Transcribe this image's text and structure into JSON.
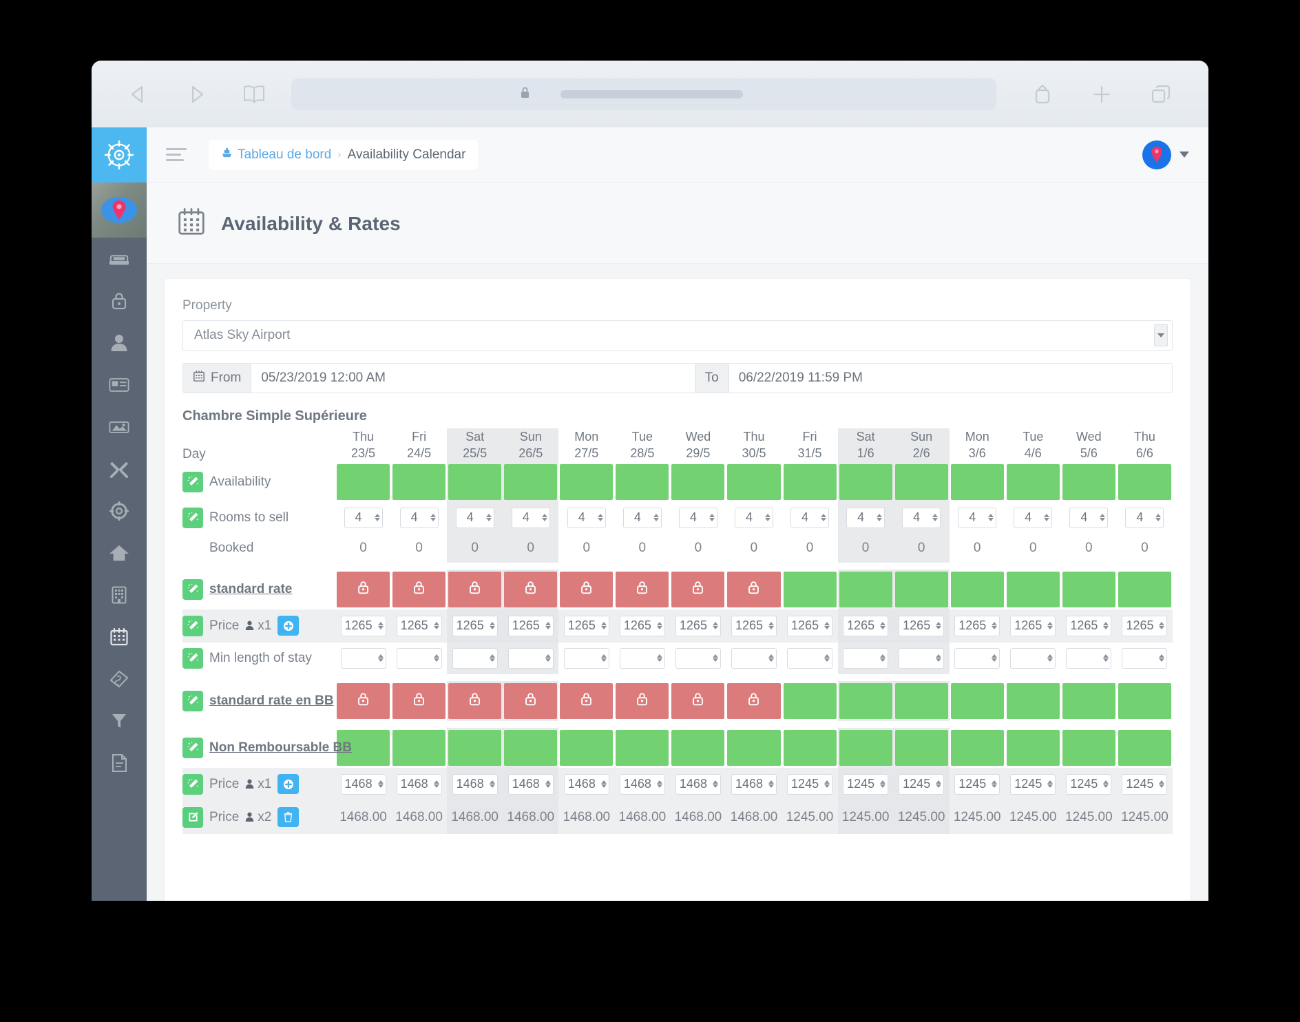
{
  "browser": {
    "back_icon": "chevron-left-icon",
    "forward_icon": "chevron-right-icon",
    "bookmarks_icon": "book-icon",
    "lock_icon": "lock-icon",
    "share_icon": "share-icon",
    "new_tab_icon": "plus-icon",
    "tabs_icon": "tabs-icon",
    "url_value": ""
  },
  "sidebar": {
    "logo_icon": "ship-wheel-icon",
    "property_icon": "map-pin-icon",
    "items": [
      {
        "icon": "bed-icon",
        "name": "sidebar-item-rooms"
      },
      {
        "icon": "lock-icon",
        "name": "sidebar-item-security"
      },
      {
        "icon": "user-icon",
        "name": "sidebar-item-users"
      },
      {
        "icon": "id-card-icon",
        "name": "sidebar-item-profile"
      },
      {
        "icon": "images-icon",
        "name": "sidebar-item-photos"
      },
      {
        "icon": "tools-icon",
        "name": "sidebar-item-tools"
      },
      {
        "icon": "gear-icon",
        "name": "sidebar-item-settings"
      },
      {
        "icon": "home-icon",
        "name": "sidebar-item-home"
      },
      {
        "icon": "building-icon",
        "name": "sidebar-item-property"
      },
      {
        "icon": "calendar-icon",
        "name": "sidebar-item-calendar"
      },
      {
        "icon": "tag-icon",
        "name": "sidebar-item-rates"
      },
      {
        "icon": "filter-icon",
        "name": "sidebar-item-filters"
      },
      {
        "icon": "invoice-icon",
        "name": "sidebar-item-invoices"
      }
    ]
  },
  "topbar": {
    "menu_icon": "hamburger-icon",
    "breadcrumb": {
      "home_icon": "ship-icon",
      "home_label": "Tableau de bord",
      "separator": "›",
      "current_label": "Availability Calendar"
    },
    "avatar_icon": "map-pin-avatar",
    "caret_icon": "chevron-down-icon"
  },
  "page": {
    "icon": "calendar-icon",
    "title": "Availability & Rates"
  },
  "filters": {
    "property_label": "Property",
    "property_value": "Atlas Sky Airport",
    "property_arrow_icon": "chevron-down-icon",
    "from_icon": "calendar-icon",
    "from_label": "From",
    "from_value": "05/23/2019 12:00 AM",
    "to_label": "To",
    "to_value": "06/22/2019 11:59 PM"
  },
  "calendar": {
    "room_title": "Chambre Simple Supérieure",
    "day_header_label": "Day",
    "days": [
      {
        "dow": "Thu",
        "date": "23/5",
        "weekend": false
      },
      {
        "dow": "Fri",
        "date": "24/5",
        "weekend": false
      },
      {
        "dow": "Sat",
        "date": "25/5",
        "weekend": true
      },
      {
        "dow": "Sun",
        "date": "26/5",
        "weekend": true
      },
      {
        "dow": "Mon",
        "date": "27/5",
        "weekend": false
      },
      {
        "dow": "Tue",
        "date": "28/5",
        "weekend": false
      },
      {
        "dow": "Wed",
        "date": "29/5",
        "weekend": false
      },
      {
        "dow": "Thu",
        "date": "30/5",
        "weekend": false
      },
      {
        "dow": "Fri",
        "date": "31/5",
        "weekend": false
      },
      {
        "dow": "Sat",
        "date": "1/6",
        "weekend": true
      },
      {
        "dow": "Sun",
        "date": "2/6",
        "weekend": true
      },
      {
        "dow": "Mon",
        "date": "3/6",
        "weekend": false
      },
      {
        "dow": "Tue",
        "date": "4/6",
        "weekend": false
      },
      {
        "dow": "Wed",
        "date": "5/6",
        "weekend": false
      },
      {
        "dow": "Thu",
        "date": "6/6",
        "weekend": false
      }
    ],
    "rows": [
      {
        "name": "availability-row",
        "label": "Availability",
        "wand_icon": "magic-wand-icon",
        "type": "bar",
        "values": [
          "green",
          "green",
          "green",
          "green",
          "green",
          "green",
          "green",
          "green",
          "green",
          "green",
          "green",
          "green",
          "green",
          "green",
          "green"
        ]
      },
      {
        "name": "rooms-to-sell-row",
        "label": "Rooms to sell",
        "wand_icon": "magic-wand-icon",
        "type": "spinner",
        "values": [
          "4",
          "4",
          "4",
          "4",
          "4",
          "4",
          "4",
          "4",
          "4",
          "4",
          "4",
          "4",
          "4",
          "4",
          "4"
        ]
      },
      {
        "name": "booked-row",
        "label": "Booked",
        "wand_icon": null,
        "type": "text",
        "values": [
          "0",
          "0",
          "0",
          "0",
          "0",
          "0",
          "0",
          "0",
          "0",
          "0",
          "0",
          "0",
          "0",
          "0",
          "0"
        ]
      },
      {
        "name": "standard-rate-row",
        "label": "standard rate",
        "wand_icon": "magic-wand-icon",
        "type": "bar",
        "link": true,
        "values": [
          "red",
          "red",
          "red",
          "red",
          "red",
          "red",
          "red",
          "red",
          "green",
          "green",
          "green",
          "green",
          "green",
          "green",
          "green"
        ]
      },
      {
        "name": "standard-rate-price-x1-row",
        "label": "Price",
        "occupancy": "x1",
        "occupancy_icon": "person-icon",
        "wand_icon": "magic-wand-icon",
        "action_icon": "plus-circle-icon",
        "shaded": true,
        "type": "spinner-wide",
        "values": [
          "1265",
          "1265",
          "1265",
          "1265",
          "1265",
          "1265",
          "1265",
          "1265",
          "1265",
          "1265",
          "1265",
          "1265",
          "1265",
          "1265",
          "1265"
        ]
      },
      {
        "name": "min-length-of-stay-row",
        "label": "Min length of stay",
        "wand_icon": "magic-wand-icon",
        "type": "spinner-empty",
        "values": [
          "",
          "",
          "",
          "",
          "",
          "",
          "",
          "",
          "",
          "",
          "",
          "",
          "",
          "",
          ""
        ]
      },
      {
        "name": "standard-rate-en-bb-row",
        "label": "standard rate en BB",
        "wand_icon": "magic-wand-icon",
        "type": "bar",
        "link": true,
        "values": [
          "red",
          "red",
          "red",
          "red",
          "red",
          "red",
          "red",
          "red",
          "green",
          "green",
          "green",
          "green",
          "green",
          "green",
          "green"
        ]
      },
      {
        "name": "non-remboursable-bb-row",
        "label": "Non Remboursable BB",
        "wand_icon": "magic-wand-icon",
        "type": "bar",
        "link": true,
        "values": [
          "green",
          "green",
          "green",
          "green",
          "green",
          "green",
          "green",
          "green",
          "green",
          "green",
          "green",
          "green",
          "green",
          "green",
          "green"
        ]
      },
      {
        "name": "non-remboursable-price-x1-row",
        "label": "Price",
        "occupancy": "x1",
        "occupancy_icon": "person-icon",
        "wand_icon": "magic-wand-icon",
        "action_icon": "plus-circle-icon",
        "shaded": true,
        "type": "spinner-wide",
        "values": [
          "1468",
          "1468",
          "1468",
          "1468",
          "1468",
          "1468",
          "1468",
          "1468",
          "1245",
          "1245",
          "1245",
          "1245",
          "1245",
          "1245",
          "1245"
        ]
      },
      {
        "name": "non-remboursable-price-x2-row",
        "label": "Price",
        "occupancy": "x2",
        "occupancy_icon": "person-icon",
        "wand_icon": "edit-icon",
        "action_icon": "trash-icon",
        "shaded": true,
        "type": "text-price",
        "values": [
          "1468.00",
          "1468.00",
          "1468.00",
          "1468.00",
          "1468.00",
          "1468.00",
          "1468.00",
          "1468.00",
          "1245.00",
          "1245.00",
          "1245.00",
          "1245.00",
          "1245.00",
          "1245.00",
          "1245.00"
        ]
      }
    ],
    "cell_lock_icon": "lock-icon"
  },
  "colors": {
    "accent_blue": "#4db8ef",
    "green": "#72d170",
    "red": "#dc7b7b",
    "sidebar": "#5b6573",
    "wand_green": "#5cd07c",
    "chip_blue": "#40b3f0"
  }
}
